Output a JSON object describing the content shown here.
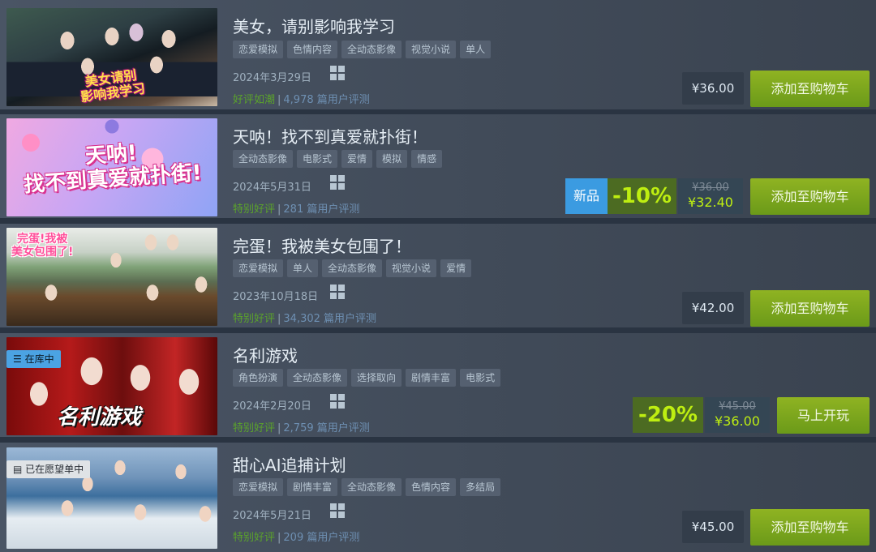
{
  "games": [
    {
      "title": "美女，请别影响我学习",
      "tags": [
        "恋爱模拟",
        "色情内容",
        "全动态影像",
        "视觉小说",
        "单人"
      ],
      "date": "2024年3月29日",
      "review_grade": "好评如潮",
      "review_count": "4,978 篇用户评测",
      "price": "¥36.00",
      "button": "添加至购物车",
      "thumb_text": "美女请别\n影响我学习"
    },
    {
      "title": "天呐！找不到真爱就扑街！",
      "tags": [
        "全动态影像",
        "电影式",
        "爱情",
        "模拟",
        "情感"
      ],
      "date": "2024年5月31日",
      "review_grade": "特别好评",
      "review_count": "281 篇用户评测",
      "new_label": "新品",
      "discount": "-10%",
      "original_price": "¥36.00",
      "final_price": "¥32.40",
      "button": "添加至购物车",
      "thumb_text": "天呐!\n找不到真爱就扑街!"
    },
    {
      "title": "完蛋！我被美女包围了！",
      "tags": [
        "恋爱模拟",
        "单人",
        "全动态影像",
        "视觉小说",
        "爱情"
      ],
      "date": "2023年10月18日",
      "review_grade": "特别好评",
      "review_count": "34,302 篇用户评测",
      "price": "¥42.00",
      "button": "添加至购物车",
      "thumb_text": "完蛋!我被\n美女包围了!"
    },
    {
      "title": "名利游戏",
      "tags": [
        "角色扮演",
        "全动态影像",
        "选择取向",
        "剧情丰富",
        "电影式"
      ],
      "date": "2024年2月20日",
      "review_grade": "特别好评",
      "review_count": "2,759 篇用户评测",
      "library_badge": "在库中",
      "discount": "-20%",
      "original_price": "¥45.00",
      "final_price": "¥36.00",
      "button": "马上开玩",
      "thumb_text": "名利游戏"
    },
    {
      "title": "甜心AI追捕计划",
      "tags": [
        "恋爱模拟",
        "剧情丰富",
        "全动态影像",
        "色情内容",
        "多结局"
      ],
      "date": "2024年5月21日",
      "review_grade": "特别好评",
      "review_count": "209 篇用户评测",
      "wishlist_badge": "已在愿望单中",
      "price": "¥45.00",
      "button": "添加至购物车"
    }
  ],
  "icons": {
    "platform": "windows-icon",
    "library": "library-list-icon",
    "wishlist": "wishlist-doc-icon"
  },
  "colors": {
    "cart_button": "#75a51c",
    "discount_bg": "#4c6b22",
    "discount_text": "#beee11",
    "new_badge": "#3b9be1",
    "positive_grade": "#5ba32b"
  }
}
